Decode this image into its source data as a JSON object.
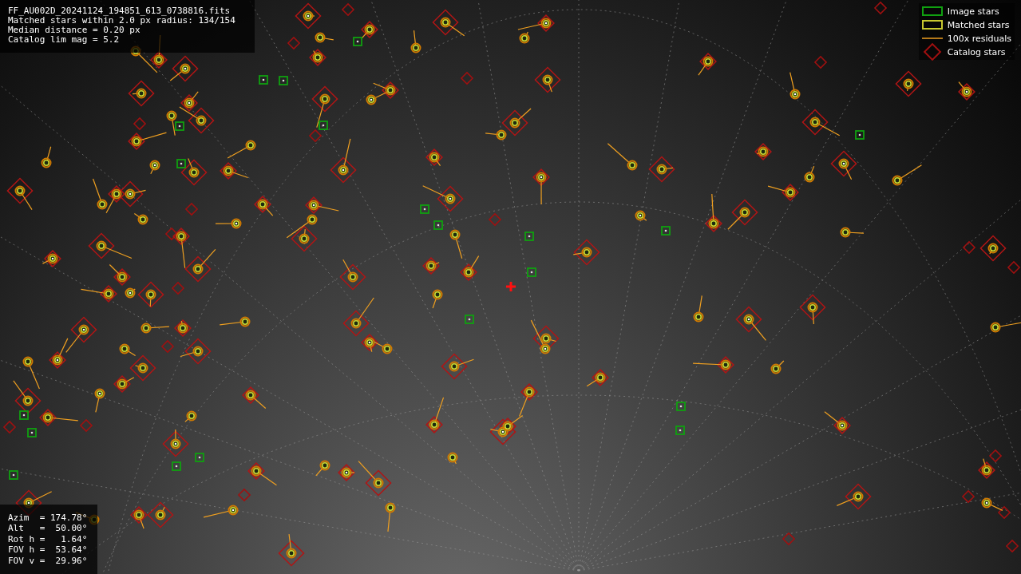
{
  "info_box": {
    "lines": [
      "FF_AU002D_20241124_194851_613_0738816.fits",
      "Matched stars within 2.0 px radius: 134/154",
      "Median distance = 0.20 px",
      "Catalog lim mag = 5.2"
    ]
  },
  "legend": [
    {
      "kind": "image",
      "label": "Image stars"
    },
    {
      "kind": "matched",
      "label": "Matched stars"
    },
    {
      "kind": "residual",
      "label": "100x residuals"
    },
    {
      "kind": "catalog",
      "label": "Catalog stars"
    }
  ],
  "pointing_box": {
    "lines": [
      "Azim  = 174.78°",
      "Alt   =  50.00°",
      "Rot h =   1.64°",
      "FOV h =  53.64°",
      "FOV v =  29.96°"
    ]
  }
}
